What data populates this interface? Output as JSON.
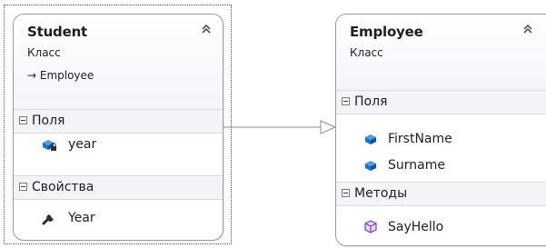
{
  "student": {
    "name": "Student",
    "kind": "Класс",
    "base": "→ Employee",
    "sections": {
      "fields_label": "Поля",
      "properties_label": "Свойства"
    },
    "fields": [
      {
        "name": "year",
        "icon": "private-field-icon"
      }
    ],
    "properties": [
      {
        "name": "Year",
        "icon": "wrench-property-icon"
      }
    ]
  },
  "employee": {
    "name": "Employee",
    "kind": "Класс",
    "sections": {
      "fields_label": "Поля",
      "methods_label": "Методы"
    },
    "fields": [
      {
        "name": "FirstName",
        "icon": "field-icon"
      },
      {
        "name": "Surname",
        "icon": "field-icon"
      }
    ],
    "methods": [
      {
        "name": "SayHello",
        "icon": "method-icon"
      }
    ]
  },
  "colors": {
    "field_blue": "#1f6fc5",
    "method_purple": "#7a3fb5",
    "border": "#9a9a9a",
    "section_bg": "#f2f4f8"
  }
}
